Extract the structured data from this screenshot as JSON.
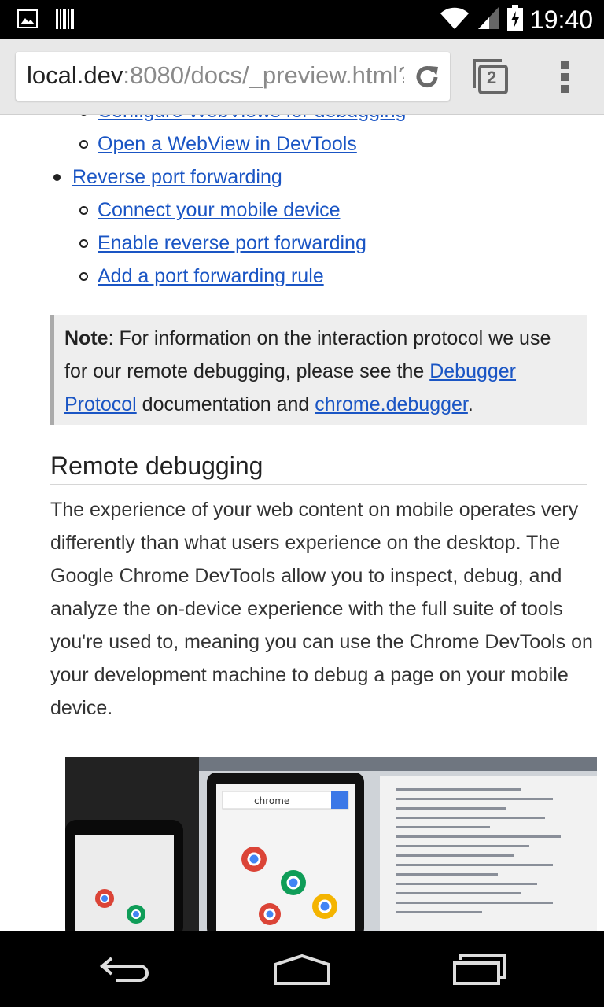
{
  "status_bar": {
    "time": "19:40",
    "left_icons": [
      "image-notification-icon",
      "barcode-notification-icon"
    ],
    "right_icons": [
      "wifi-icon",
      "cell-signal-icon",
      "battery-icon"
    ]
  },
  "toolbar": {
    "url_host": "local.dev",
    "url_rest": ":8080/docs/_preview.html?",
    "tab_count": "2",
    "icons": [
      "reload-icon",
      "tab-switcher-icon",
      "overflow-menu-icon"
    ]
  },
  "toc": {
    "items": [
      {
        "label": "Configure WebViews for debugging",
        "level": 2
      },
      {
        "label": "Open a WebView in DevTools",
        "level": 2
      },
      {
        "label": "Reverse port forwarding",
        "level": 1
      },
      {
        "label": "Connect your mobile device",
        "level": 2
      },
      {
        "label": "Enable reverse port forwarding",
        "level": 2
      },
      {
        "label": "Add a port forwarding rule",
        "level": 2
      }
    ]
  },
  "note": {
    "label": "Note",
    "text_1": ": For information on the interaction protocol we use for our remote debugging, please see the ",
    "link_1": "Debugger Protocol",
    "text_2": " documentation and ",
    "link_2": "chrome.debugger",
    "text_3": "."
  },
  "section": {
    "heading": "Remote debugging",
    "paragraph": "The experience of your web content on mobile operates very differently than what users experience on the desktop. The Google Chrome DevTools allow you to inspect, debug, and analyze the on-device experience with the full suite of tools you're used to, meaning you can use the Chrome DevTools on your development machine to debug a page on your mobile device."
  },
  "photo": {
    "description_icon": "devtools-photo-image",
    "screen_text": "chrome"
  },
  "nav_bar": {
    "icons": [
      "back-icon",
      "home-icon",
      "recent-apps-icon"
    ]
  }
}
